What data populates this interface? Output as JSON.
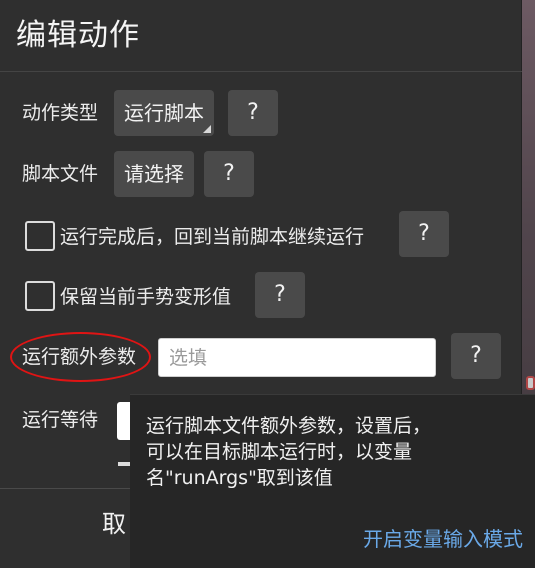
{
  "dialog": {
    "title": "编辑动作",
    "action_type": {
      "label": "动作类型",
      "value": "运行脚本",
      "help": "?"
    },
    "script_file": {
      "label": "脚本文件",
      "value": "请选择",
      "help": "?"
    },
    "continue_after": {
      "label": "运行完成后，回到当前脚本继续运行",
      "checked": false,
      "help": "?"
    },
    "keep_transform": {
      "label": "保留当前手势变形值",
      "checked": false,
      "help": "?"
    },
    "extra_args": {
      "label": "运行额外参数",
      "value": "",
      "placeholder": "选填",
      "help": "?"
    },
    "wait": {
      "label": "运行等待"
    },
    "cancel_label": "取"
  },
  "tooltip": {
    "lines": [
      "运行脚本文件额外参数，设置后，",
      "可以在目标脚本运行时，以变量",
      "名\"runArgs\"取到该值"
    ],
    "link": "开启变量输入模式"
  },
  "colors": {
    "dialog_bg": "#2f2f2f",
    "chip_bg": "#4a4a4a",
    "tooltip_bg": "#262626",
    "link": "#6aa9e8",
    "annotation": "#e01414"
  }
}
